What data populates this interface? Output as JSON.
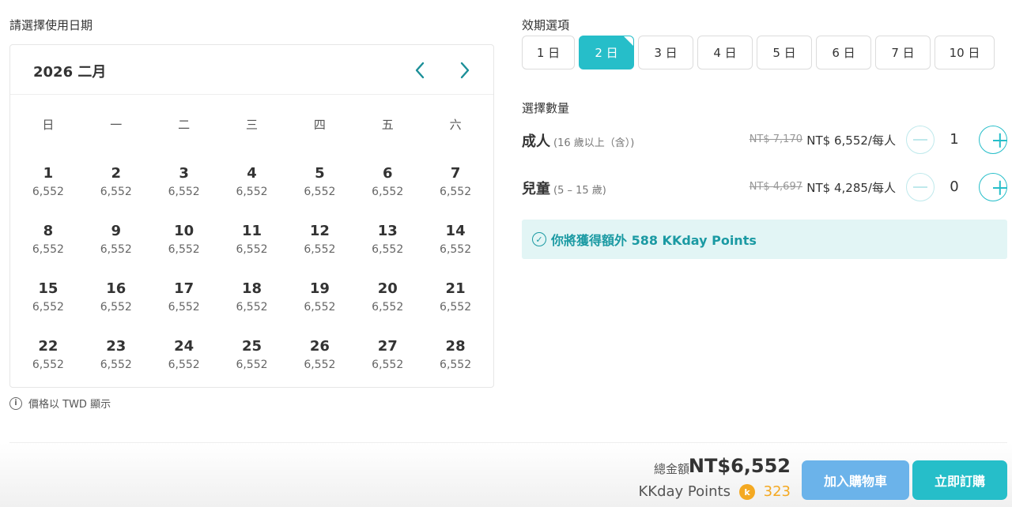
{
  "date_section": {
    "label": "請選擇使用日期"
  },
  "calendar": {
    "month_title": "2026 二月",
    "prev_icon": "chevron-left-icon",
    "next_icon": "chevron-right-icon",
    "weekdays": [
      "日",
      "一",
      "二",
      "三",
      "四",
      "五",
      "六"
    ],
    "weeks": [
      [
        {
          "d": "1",
          "p": "6,552"
        },
        {
          "d": "2",
          "p": "6,552"
        },
        {
          "d": "3",
          "p": "6,552"
        },
        {
          "d": "4",
          "p": "6,552"
        },
        {
          "d": "5",
          "p": "6,552"
        },
        {
          "d": "6",
          "p": "6,552"
        },
        {
          "d": "7",
          "p": "6,552"
        }
      ],
      [
        {
          "d": "8",
          "p": "6,552"
        },
        {
          "d": "9",
          "p": "6,552"
        },
        {
          "d": "10",
          "p": "6,552"
        },
        {
          "d": "11",
          "p": "6,552"
        },
        {
          "d": "12",
          "p": "6,552"
        },
        {
          "d": "13",
          "p": "6,552"
        },
        {
          "d": "14",
          "p": "6,552"
        }
      ],
      [
        {
          "d": "15",
          "p": "6,552"
        },
        {
          "d": "16",
          "p": "6,552"
        },
        {
          "d": "17",
          "p": "6,552"
        },
        {
          "d": "18",
          "p": "6,552"
        },
        {
          "d": "19",
          "p": "6,552"
        },
        {
          "d": "20",
          "p": "6,552"
        },
        {
          "d": "21",
          "p": "6,552"
        }
      ],
      [
        {
          "d": "22",
          "p": "6,552"
        },
        {
          "d": "23",
          "p": "6,552"
        },
        {
          "d": "24",
          "p": "6,552"
        },
        {
          "d": "25",
          "p": "6,552"
        },
        {
          "d": "26",
          "p": "6,552"
        },
        {
          "d": "27",
          "p": "6,552"
        },
        {
          "d": "28",
          "p": "6,552"
        }
      ]
    ]
  },
  "currency_note": {
    "icon": "info-icon",
    "text": "價格以 TWD 顯示"
  },
  "period_section": {
    "label": "效期選項",
    "options": [
      "1 日",
      "2 日",
      "3 日",
      "4 日",
      "5 日",
      "6 日",
      "7 日",
      "10 日"
    ],
    "selected": "2 日"
  },
  "quantity_section": {
    "label": "選擇數量",
    "adult": {
      "name": "成人",
      "note": "(16 歲以上（含）)",
      "old_price": "NT$ 7,170",
      "price": "NT$ 6,552/每人",
      "qty": "1"
    },
    "child": {
      "name": "兒童",
      "note": "(5 – 15 歲)",
      "old_price": "NT$ 4,697",
      "price": "NT$ 4,285/每人",
      "qty": "0"
    }
  },
  "points_banner": {
    "icon": "check-circle-icon",
    "text": "你將獲得額外 588 KKday Points"
  },
  "footer": {
    "total_label": "總金額",
    "total_amount": "NT$6,552",
    "points_label": "KKday Points",
    "coin_icon": "kkday-coin-icon",
    "coin_glyph": "k",
    "points_value": "323",
    "add_to_cart": "加入購物車",
    "book_now": "立即訂購"
  },
  "colors": {
    "accent": "#26bec9",
    "cart_button": "#6bb3ea",
    "points": "#f4a922",
    "banner_bg": "#e2f5f5"
  }
}
